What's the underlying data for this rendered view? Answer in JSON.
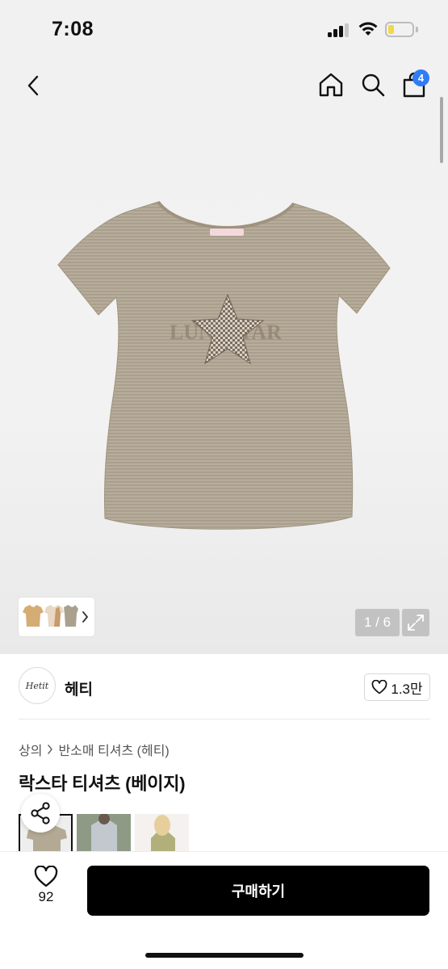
{
  "status_bar": {
    "time": "7:08",
    "battery_color": "#f2d84a"
  },
  "header": {
    "back_icon": "chevron-left-icon",
    "home_icon": "home-icon",
    "search_icon": "search-icon",
    "cart_icon": "shopping-bag-icon",
    "cart_badge": "4",
    "badge_color": "#2f7cf6"
  },
  "gallery": {
    "page_indicator": "1 / 6",
    "expand_icon": "expand-icon",
    "thumb_next_icon": "chevron-right-icon",
    "current_page": 1,
    "total_pages": 6
  },
  "brand": {
    "logo_text": "Hetit",
    "name": "헤티"
  },
  "likes": {
    "label": "1.3만",
    "icon": "heart-outline-icon"
  },
  "breadcrumb": {
    "level1": "상의",
    "level2": "반소매 티셔츠 (헤티)"
  },
  "product": {
    "title": "락스타 티셔츠 (베이지)"
  },
  "share": {
    "icon": "share-icon"
  },
  "bottom": {
    "wish_count": "92",
    "buy_label": "구매하기",
    "buy_color": "#000000"
  }
}
